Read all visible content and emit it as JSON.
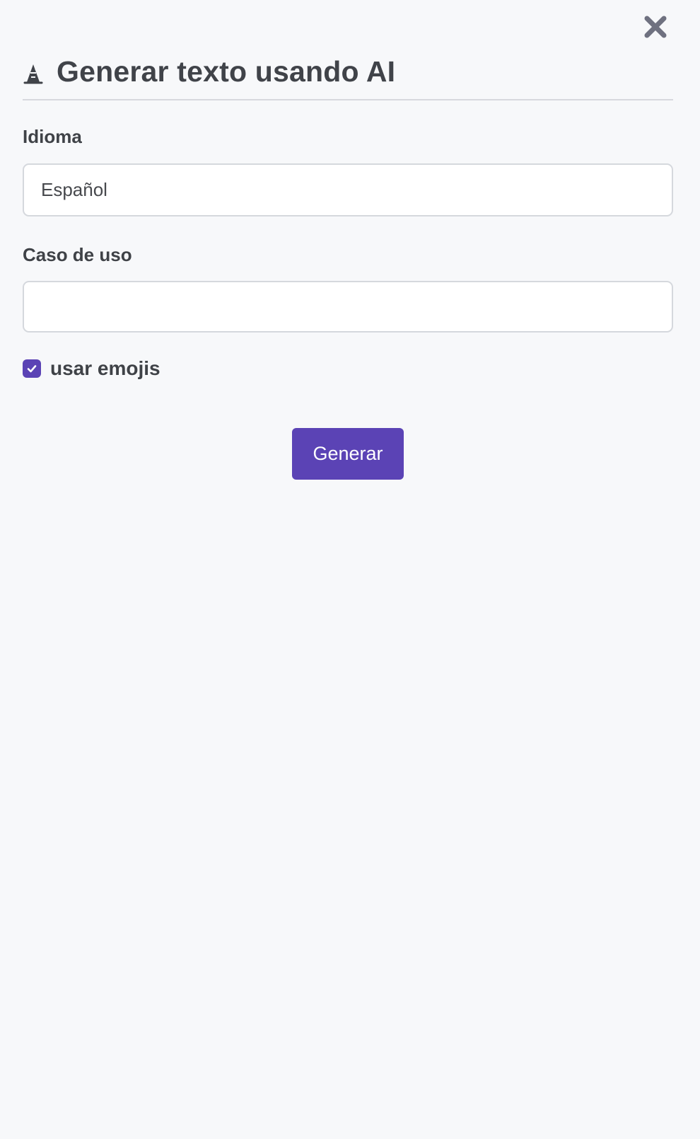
{
  "header": {
    "title": "Generar texto usando AI",
    "icon": "wizard-hat-icon"
  },
  "fields": {
    "language": {
      "label": "Idioma",
      "value": "Español"
    },
    "use_case": {
      "label": "Caso de uso",
      "value": "",
      "placeholder": ""
    }
  },
  "options": {
    "use_emojis": {
      "label": "usar emojis",
      "checked": true
    }
  },
  "actions": {
    "generate_label": "Generar",
    "close_icon": "close-icon"
  },
  "colors": {
    "accent": "#5b43b5",
    "background": "#f7f8fa",
    "text": "#3f4247",
    "border": "#d5d8dd",
    "close_icon": "#6f7180"
  }
}
